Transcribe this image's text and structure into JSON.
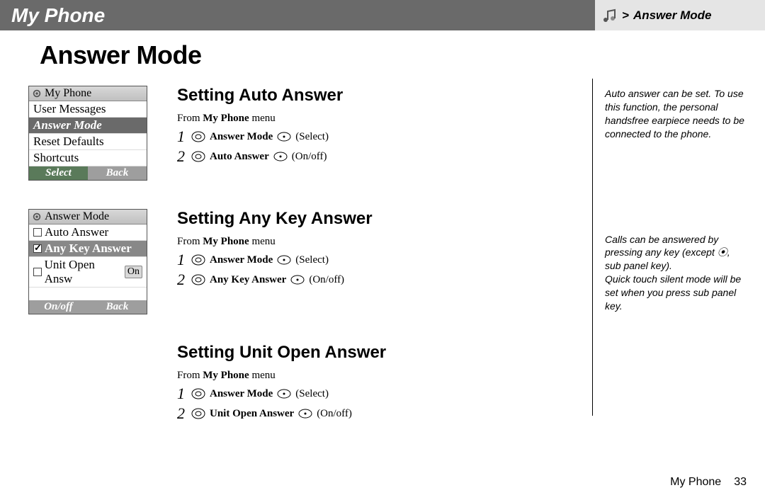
{
  "header": {
    "left": "My Phone",
    "right_prefix": "> ",
    "right": "Answer Mode"
  },
  "page_title": "Answer Mode",
  "sections": [
    {
      "heading": "Setting Auto Answer",
      "from_prefix": "From ",
      "from_bold": "My Phone",
      "from_suffix": " menu",
      "steps": [
        {
          "n": "1",
          "action": "Answer Mode",
          "hint": "(Select)"
        },
        {
          "n": "2",
          "action": "Auto Answer",
          "hint": "(On/off)"
        }
      ],
      "screenshot": "myphone"
    },
    {
      "heading": "Setting Any Key Answer",
      "from_prefix": "From ",
      "from_bold": "My Phone",
      "from_suffix": " menu",
      "steps": [
        {
          "n": "1",
          "action": "Answer Mode",
          "hint": "(Select)"
        },
        {
          "n": "2",
          "action": "Any Key Answer",
          "hint": "(On/off)"
        }
      ],
      "screenshot": "answermode"
    },
    {
      "heading": "Setting Unit Open Answer",
      "from_prefix": "From ",
      "from_bold": "My Phone",
      "from_suffix": " menu",
      "steps": [
        {
          "n": "1",
          "action": "Answer Mode",
          "hint": "(Select)"
        },
        {
          "n": "2",
          "action": "Unit Open Answer",
          "hint": "(On/off)"
        }
      ],
      "screenshot": null
    }
  ],
  "screens": {
    "myphone": {
      "title": "My Phone",
      "rows": [
        {
          "label": "User Messages",
          "sel": false
        },
        {
          "label": "Answer Mode",
          "sel": true
        },
        {
          "label": "Reset Defaults",
          "sel": false
        },
        {
          "label": "Shortcuts",
          "sel": false
        }
      ],
      "soft_left": "Select",
      "soft_right": "Back",
      "sk_left_style": "dark",
      "sk_right_style": "grey"
    },
    "answermode": {
      "title": "Answer Mode",
      "rows": [
        {
          "label": "Auto Answer",
          "cbox": true,
          "checked": false,
          "sel": false
        },
        {
          "label": "Any Key Answer",
          "cbox": true,
          "checked": true,
          "sel": true
        },
        {
          "label": "Unit Open Answ",
          "cbox": true,
          "checked": false,
          "sel": false,
          "badge": "On"
        }
      ],
      "spacer": true,
      "soft_left": "On/off",
      "soft_right": "Back",
      "sk_left_style": "grey",
      "sk_right_style": "grey"
    }
  },
  "sidenotes": [
    "Auto answer can be set. To use this function, the personal handsfree earpiece needs to be connected to the phone.",
    "Calls can be answered by pressing any key (except ⦿, sub panel key).\nQuick touch silent mode will be set when you press sub panel key."
  ],
  "footer": {
    "name": "My Phone",
    "num": "33"
  }
}
